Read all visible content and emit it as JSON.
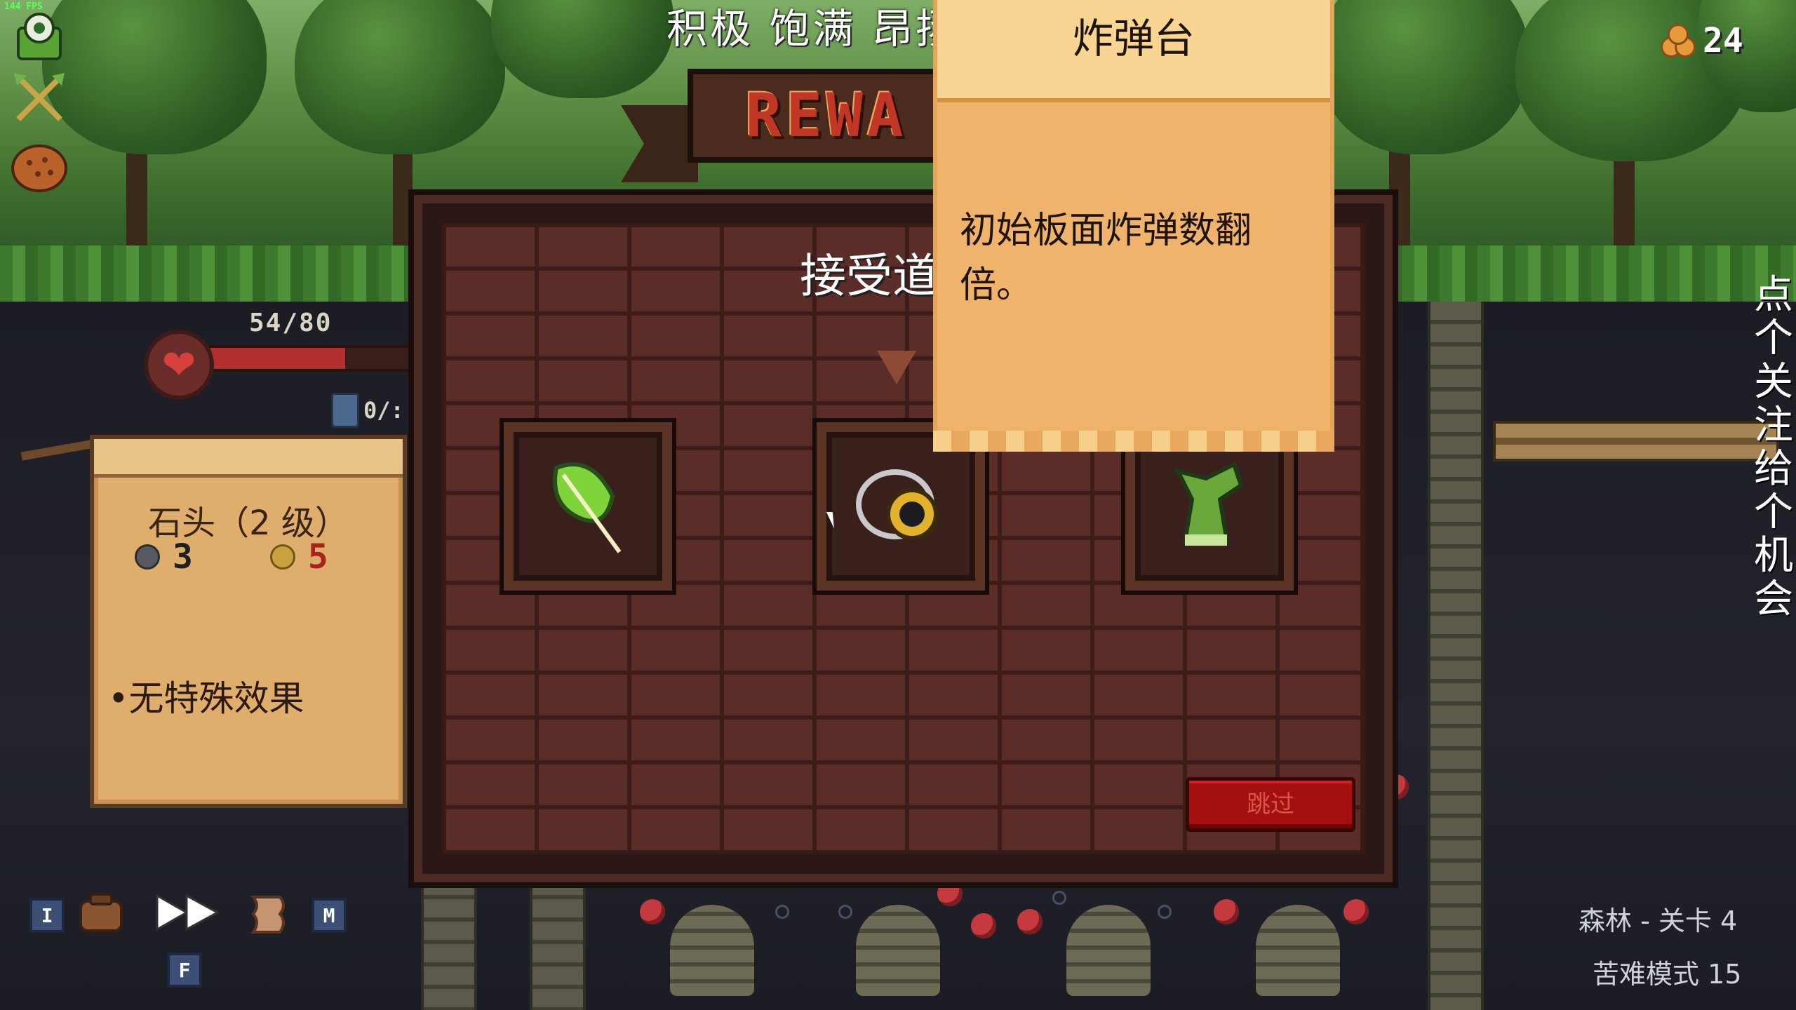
{
  "hud": {
    "fps": "144 FPS",
    "icons": [
      "eye-monster-icon",
      "crossed-arrows-icon",
      "cookie-icon"
    ],
    "coins": "24",
    "hp": "54/80",
    "hp_fraction": 0.675,
    "discard": "0/:"
  },
  "subtitle": "积极 饱满 昂扬 坚定 自信 乐观",
  "reward": {
    "banner": "REWA",
    "prompt": "接受道",
    "slots": [
      {
        "icon": "green-leaf-icon"
      },
      {
        "icon": "bomb-amulet-icon"
      },
      {
        "icon": "green-goblin-statue-icon"
      }
    ],
    "skip_label": "跳过"
  },
  "tooltip": {
    "title": "炸弹台",
    "description": "初始板面炸弹数翻倍。"
  },
  "info_card": {
    "title": "石头（2 级）",
    "stat_gray": "3",
    "stat_gold": "5",
    "effect": "•无特殊效果"
  },
  "toolbar": {
    "inventory_key": "I",
    "map_key": "M",
    "fast_key": "F"
  },
  "side_text": "点个关注，给个机会",
  "level": {
    "name": "森林 - 关卡 4",
    "difficulty": "苦难模式 15"
  },
  "colors": {
    "skip_button": "#a3100f",
    "tooltip_paper": "#f0b36c",
    "board_brick": "#5b2d29"
  }
}
